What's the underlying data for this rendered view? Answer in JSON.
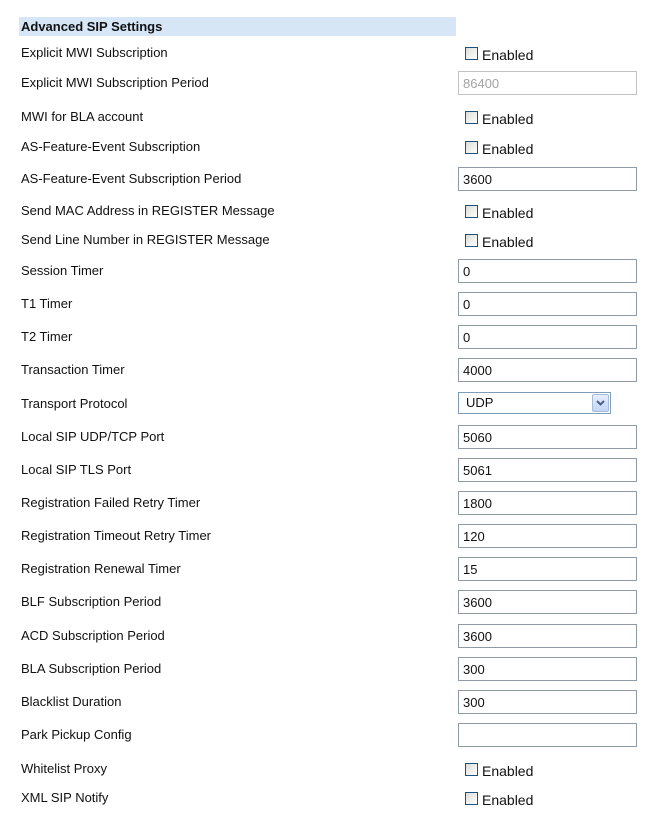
{
  "section_title": "Advanced SIP Settings",
  "checkbox_label": "Enabled",
  "rows": [
    {
      "label": "Explicit MWI Subscription",
      "type": "checkbox",
      "checked": false
    },
    {
      "label": "Explicit MWI Subscription Period",
      "type": "text",
      "value": "86400",
      "disabled": true
    },
    {
      "label": "MWI for BLA account",
      "type": "checkbox",
      "checked": false
    },
    {
      "label": "AS-Feature-Event Subscription",
      "type": "checkbox",
      "checked": false
    },
    {
      "label": "AS-Feature-Event Subscription Period",
      "type": "text",
      "value": "3600"
    },
    {
      "label": "Send MAC Address in REGISTER Message",
      "type": "checkbox",
      "checked": false
    },
    {
      "label": "Send Line Number in REGISTER Message",
      "type": "checkbox",
      "checked": false
    },
    {
      "label": "Session Timer",
      "type": "text",
      "value": "0"
    },
    {
      "label": "T1 Timer",
      "type": "text",
      "value": "0"
    },
    {
      "label": "T2 Timer",
      "type": "text",
      "value": "0"
    },
    {
      "label": "Transaction Timer",
      "type": "text",
      "value": "4000"
    },
    {
      "label": "Transport Protocol",
      "type": "select",
      "value": "UDP"
    },
    {
      "label": "Local SIP UDP/TCP Port",
      "type": "text",
      "value": "5060"
    },
    {
      "label": "Local SIP TLS Port",
      "type": "text",
      "value": "5061"
    },
    {
      "label": "Registration Failed Retry Timer",
      "type": "text",
      "value": "1800"
    },
    {
      "label": "Registration Timeout Retry Timer",
      "type": "text",
      "value": "120"
    },
    {
      "label": "Registration Renewal Timer",
      "type": "text",
      "value": "15"
    },
    {
      "label": "BLF Subscription Period",
      "type": "text",
      "value": "3600"
    },
    {
      "label": "ACD Subscription Period",
      "type": "text",
      "value": "3600"
    },
    {
      "label": "BLA Subscription Period",
      "type": "text",
      "value": "300"
    },
    {
      "label": "Blacklist Duration",
      "type": "text",
      "value": "300"
    },
    {
      "label": "Park Pickup Config",
      "type": "text",
      "value": ""
    },
    {
      "label": "Whitelist Proxy",
      "type": "checkbox",
      "checked": false
    },
    {
      "label": "XML SIP Notify",
      "type": "checkbox",
      "checked": false
    }
  ]
}
